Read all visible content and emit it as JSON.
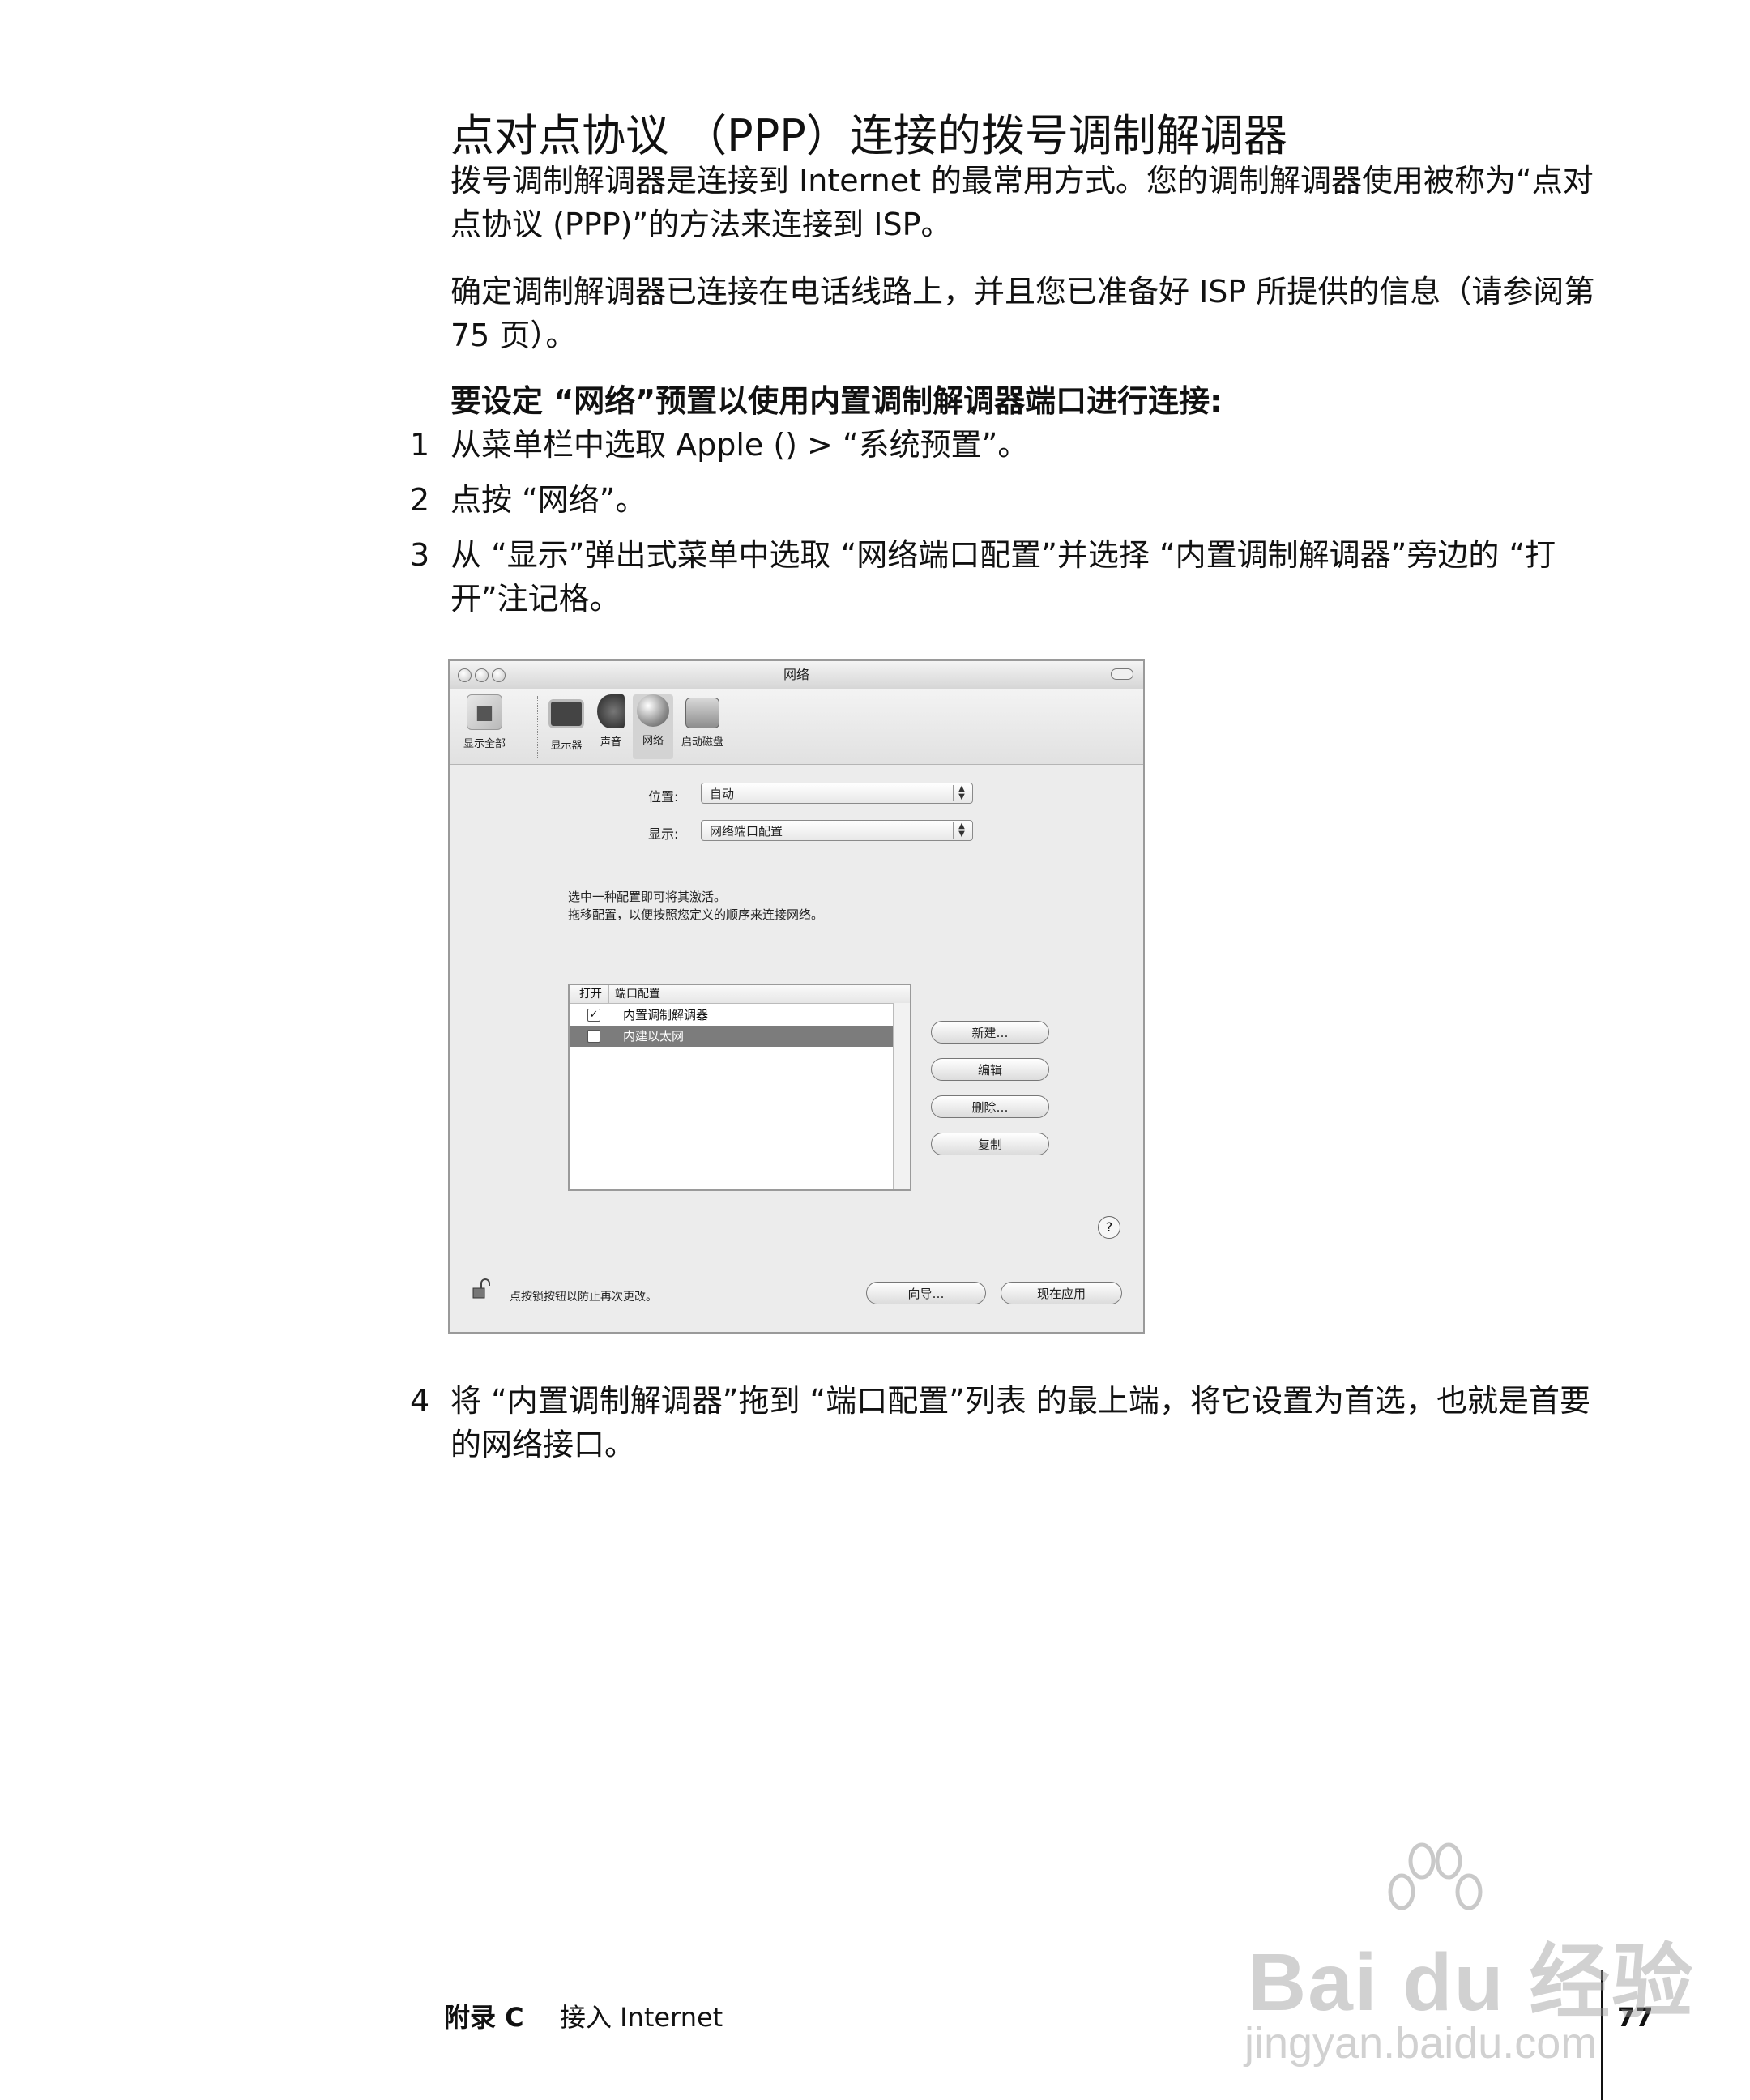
{
  "heading": "点对点协议 （PPP）连接的拨号调制解调器",
  "intro_para": "拨号调制解调器是连接到 Internet 的最常用方式。您的调制解调器使用被称为“点对点协议 (PPP)”的方法来连接到 ISP。",
  "confirm_para": "确定调制解调器已连接在电话线路上，并且您已准备好 ISP 所提供的信息（请参阅第 75 页）。",
  "procedure_title": "要设定 “网络”预置以使用内置调制解调器端口进行连接:",
  "steps": [
    {
      "num": "1",
      "text": "从菜单栏中选取 Apple () > “系统预置”。"
    },
    {
      "num": "2",
      "text": "点按 “网络”。"
    },
    {
      "num": "3",
      "text": "从 “显示”弹出式菜单中选取 “网络端口配置”并选择 “内置调制解调器”旁边的 “打开”注记格。"
    },
    {
      "num": "4",
      "text": "将 “内置调制解调器”拖到 “端口配置”列表 的最上端，将它设置为首选，也就是首要的网络接口。"
    }
  ],
  "screenshot": {
    "window_title": "网络",
    "toolbar": [
      "显示全部",
      "显示器",
      "声音",
      "网络",
      "启动磁盘"
    ],
    "location_label": "位置:",
    "location_value": "自动",
    "show_label": "显示:",
    "show_value": "网络端口配置",
    "instructions": [
      "选中一种配置即可将其激活。",
      "拖移配置，以便按照您定义的顺序来连接网络。"
    ],
    "list_headers": {
      "on": "打开",
      "config": "端口配置"
    },
    "ports": [
      {
        "name": "内置调制解调器",
        "checked": true,
        "selected": false
      },
      {
        "name": "内建以太网",
        "checked": false,
        "selected": true
      }
    ],
    "buttons": {
      "new": "新建…",
      "edit": "编辑",
      "delete": "删除…",
      "duplicate": "复制"
    },
    "help": "?",
    "lock_text": "点按锁按钮以防止再次更改。",
    "assist": "向导…",
    "apply": "现在应用"
  },
  "footer": {
    "appendix": "附录 C",
    "section": "接入 Internet",
    "page": "77"
  },
  "watermark": {
    "brand": "Bai du 经验",
    "url": "jingyan.baidu.com"
  }
}
